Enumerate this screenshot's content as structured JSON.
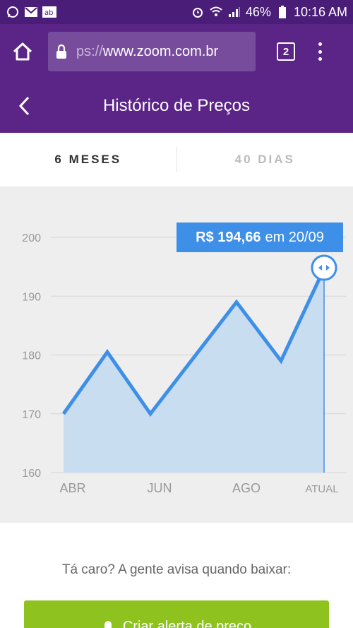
{
  "status_bar": {
    "battery": "46%",
    "time": "10:16 AM"
  },
  "browser": {
    "url_prefix": "ps://",
    "url": "www.zoom.com.br",
    "tab_count": "2"
  },
  "header": {
    "title": "Histórico de Preços"
  },
  "tabs": [
    {
      "label": "6 MESES",
      "active": true
    },
    {
      "label": "40 DIAS",
      "active": false
    }
  ],
  "tooltip": {
    "price": "R$ 194,66",
    "date_text": "em 20/09"
  },
  "chart_data": {
    "type": "area",
    "x": [
      "ABR",
      "",
      "JUN",
      "",
      "AGO",
      "",
      "ATUAL"
    ],
    "values": [
      170,
      180.5,
      170,
      179.5,
      189,
      179,
      194.66
    ],
    "ylim": [
      160,
      200
    ],
    "yticks": [
      160,
      170,
      180,
      190,
      200
    ],
    "xtick_labels": [
      "ABR",
      "JUN",
      "AGO",
      "ATUAL"
    ],
    "grid": true,
    "line_color": "#3d8fe8",
    "fill_color": "#c9ddf1"
  },
  "cta": {
    "prompt": "Tá caro? A gente avisa quando baixar:",
    "button_label": "Criar alerta de preço"
  }
}
